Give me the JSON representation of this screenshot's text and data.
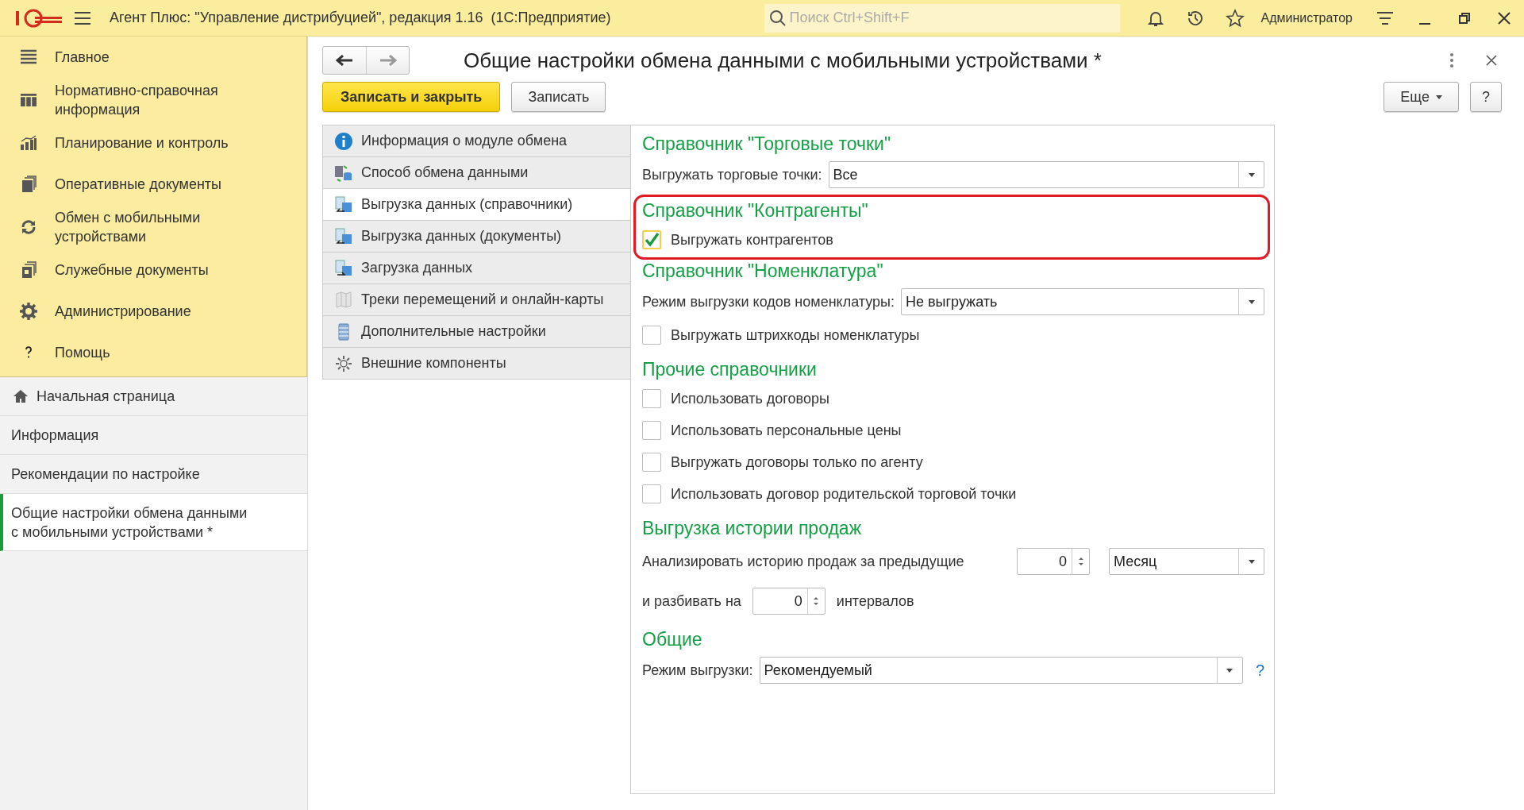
{
  "app_bar": {
    "title": "Агент Плюс: \"Управление дистрибуцией\", редакция 1.16  (1С:Предприятие)",
    "search": {
      "placeholder": "Поиск Ctrl+Shift+F"
    },
    "user": "Администратор"
  },
  "sections_panel": {
    "items": [
      {
        "label": "Главное"
      },
      {
        "label": "Нормативно-справочная информация"
      },
      {
        "label": "Планирование и контроль"
      },
      {
        "label": "Оперативные документы"
      },
      {
        "label": "Обмен с мобильными устройствами"
      },
      {
        "label": "Служебные документы"
      },
      {
        "label": "Администрирование"
      },
      {
        "label": "Помощь"
      }
    ]
  },
  "open_windows": [
    {
      "label": "Начальная страница",
      "kind": "home",
      "selected": false
    },
    {
      "label": "Информация",
      "kind": "plain",
      "selected": false
    },
    {
      "label": "Рекомендации по настройке",
      "kind": "plain",
      "selected": false
    },
    {
      "label": "Общие настройки обмена данными\nс мобильными устройствами *",
      "kind": "plain",
      "selected": true
    }
  ],
  "form": {
    "title": "Общие настройки обмена данными с мобильными устройствами *",
    "buttons": [
      {
        "label": "Записать и закрыть",
        "kind": "primary"
      },
      {
        "label": "Записать",
        "kind": "default"
      }
    ],
    "more_button": "Еще",
    "help_button": "?",
    "pages": [
      {
        "label": "Информация о модуле обмена",
        "selected": false
      },
      {
        "label": "Способ обмена данными",
        "selected": false
      },
      {
        "label": "Выгрузка данных (справочники)",
        "selected": true
      },
      {
        "label": "Выгрузка данных (документы)",
        "selected": false
      },
      {
        "label": "Загрузка данных",
        "selected": false
      },
      {
        "label": "Треки перемещений и онлайн-карты",
        "selected": false
      },
      {
        "label": "Дополнительные настройки",
        "selected": false
      },
      {
        "label": "Внешние компоненты",
        "selected": false
      }
    ],
    "groups": [
      {
        "title": "Справочник \"Торговые точки\"",
        "highlighted": false,
        "rows": [
          {
            "kind": "select",
            "label": "Выгружать торговые точки:",
            "value": "Все"
          }
        ]
      },
      {
        "title": "Справочник \"Контрагенты\"",
        "highlighted": true,
        "rows": [
          {
            "kind": "checkbox",
            "label": "Выгружать контрагентов",
            "checked": true
          }
        ]
      },
      {
        "title": "Справочник \"Номенклатура\"",
        "highlighted": false,
        "rows": [
          {
            "kind": "select",
            "label": "Режим выгрузки кодов номенклатуры:",
            "value": "Не выгружать"
          },
          {
            "kind": "checkbox",
            "label": "Выгружать штрихкоды номенклатуры",
            "checked": false
          }
        ]
      },
      {
        "title": "Прочие справочники",
        "highlighted": false,
        "rows": [
          {
            "kind": "checkbox",
            "label": "Использовать договоры",
            "checked": false
          },
          {
            "kind": "checkbox",
            "label": "Использовать персональные цены",
            "checked": false
          },
          {
            "kind": "checkbox",
            "label": "Выгружать договоры только по агенту",
            "checked": false
          },
          {
            "kind": "checkbox",
            "label": "Использовать договор родительской торговой точки",
            "checked": false
          }
        ]
      },
      {
        "title": "Выгрузка истории продаж",
        "highlighted": false,
        "rows": [
          {
            "kind": "period",
            "label": "Анализировать историю продаж за предыдущие",
            "number": "0",
            "unit": "Месяц"
          },
          {
            "kind": "intervals",
            "label": "и разбивать на",
            "number": "0",
            "suffix": "интервалов"
          }
        ]
      },
      {
        "title": "Общие",
        "highlighted": false,
        "rows": [
          {
            "kind": "select_help",
            "label": "Режим выгрузки:",
            "value": "Рекомендуемый",
            "help": "?"
          }
        ]
      }
    ]
  }
}
